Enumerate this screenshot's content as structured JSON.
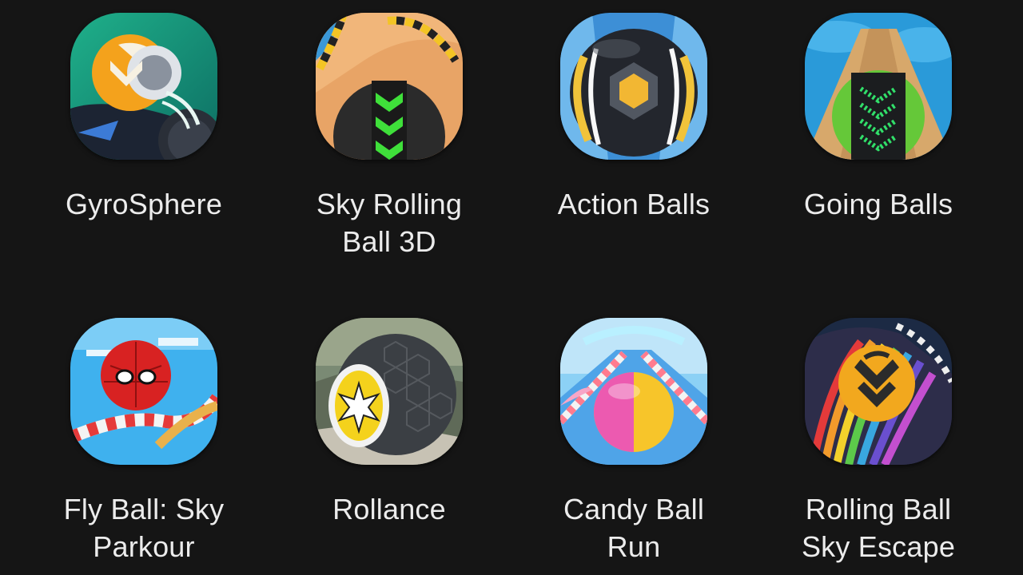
{
  "apps": [
    {
      "name": "GyroSphere",
      "icon": "gyrosphere-icon"
    },
    {
      "name": "Sky Rolling\nBall 3D",
      "icon": "sky-rolling-ball-icon"
    },
    {
      "name": "Action Balls",
      "icon": "action-balls-icon"
    },
    {
      "name": "Going Balls",
      "icon": "going-balls-icon"
    },
    {
      "name": "Fly Ball: Sky\nParkour",
      "icon": "fly-ball-icon"
    },
    {
      "name": "Rollance",
      "icon": "rollance-icon"
    },
    {
      "name": "Candy Ball\nRun",
      "icon": "candy-ball-icon"
    },
    {
      "name": "Rolling Ball\nSky Escape",
      "icon": "rolling-ball-sky-escape-icon"
    }
  ],
  "colors": {
    "background": "#151515",
    "label_text": "#ececec"
  }
}
